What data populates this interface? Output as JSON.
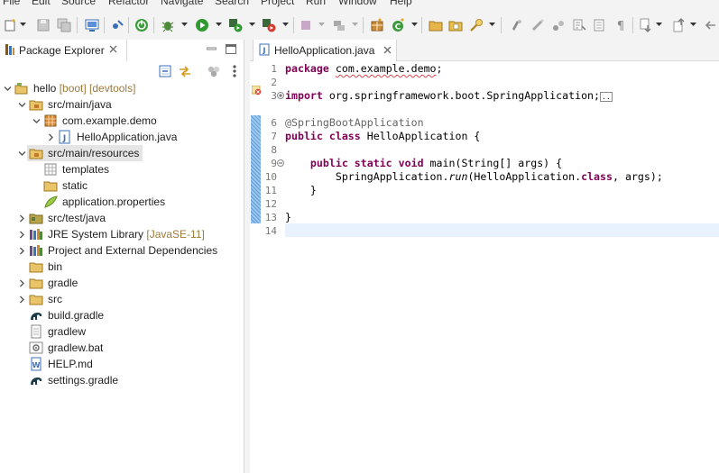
{
  "menubar": {
    "items": [
      {
        "label": "File"
      },
      {
        "label": "Edit"
      },
      {
        "label": "Source"
      },
      {
        "label": "Refactor"
      },
      {
        "label": "Navigate"
      },
      {
        "label": "Search"
      },
      {
        "label": "Project"
      },
      {
        "label": "Run"
      },
      {
        "label": "Window"
      },
      {
        "label": "Help"
      }
    ]
  },
  "colors": {
    "keyword": "#7f0055",
    "annotation": "#646464",
    "current_line": "#e8f2fe",
    "selection": "#e5e5e5",
    "tree_decoration": "#9c7b3c",
    "error_underline": "#e0434b"
  },
  "package_explorer": {
    "tab_label": "Package Explorer",
    "tab_icon": "package-explorer-icon",
    "tree": [
      {
        "label": "hello",
        "decoration": " [boot] [devtools]",
        "icon": "project-icon",
        "expanded": true
      },
      {
        "label": "src/main/java",
        "icon": "source-folder-icon",
        "expanded": true
      },
      {
        "label": "com.example.demo",
        "icon": "package-icon",
        "expanded": true
      },
      {
        "label": "HelloApplication.java",
        "icon": "java-file-icon",
        "expanded": false
      },
      {
        "label": "src/main/resources",
        "icon": "source-folder-icon",
        "expanded": true,
        "selected": true
      },
      {
        "label": "templates",
        "icon": "package-icon"
      },
      {
        "label": "static",
        "icon": "folder-icon"
      },
      {
        "label": "application.properties",
        "icon": "properties-file-icon"
      },
      {
        "label": "src/test/java",
        "icon": "source-folder-icon",
        "expanded": false
      },
      {
        "label": "JRE System Library",
        "decoration": " [JavaSE-11]",
        "icon": "library-icon",
        "expanded": false
      },
      {
        "label": "Project and External Dependencies",
        "icon": "library-icon",
        "expanded": false
      },
      {
        "label": "bin",
        "icon": "folder-icon"
      },
      {
        "label": "gradle",
        "icon": "folder-icon",
        "expanded": false
      },
      {
        "label": "src",
        "icon": "folder-icon",
        "expanded": false
      },
      {
        "label": "build.gradle",
        "icon": "gradle-file-icon"
      },
      {
        "label": "gradlew",
        "icon": "text-file-icon"
      },
      {
        "label": "gradlew.bat",
        "icon": "bat-file-icon"
      },
      {
        "label": "HELP.md",
        "icon": "markdown-file-icon"
      },
      {
        "label": "settings.gradle",
        "icon": "gradle-file-icon"
      }
    ]
  },
  "editor": {
    "tab_label": "HelloApplication.java",
    "line_numbers": [
      "1",
      "2",
      "3",
      "6",
      "7",
      "8",
      "9",
      "10",
      "11",
      "12",
      "13",
      "14"
    ],
    "code": {
      "l1_kw": "package",
      "l1_pkg": "com.example.demo",
      "l1_end": ";",
      "l3_kw": "import",
      "l3_rest": " org.springframework.boot.SpringApplication;",
      "l3_box": "..",
      "l6": "@SpringBootApplication",
      "l7_kw": "public class",
      "l7_rest": " HelloApplication {",
      "l9_indent": "    ",
      "l9_kw": "public static void",
      "l9_rest": " main(String[] args) {",
      "l10_a": "        SpringApplication.",
      "l10_run": "run",
      "l10_b": "(HelloApplication.",
      "l10_kw": "class",
      "l10_c": ", args);",
      "l11": "    }",
      "l13": "}"
    }
  }
}
